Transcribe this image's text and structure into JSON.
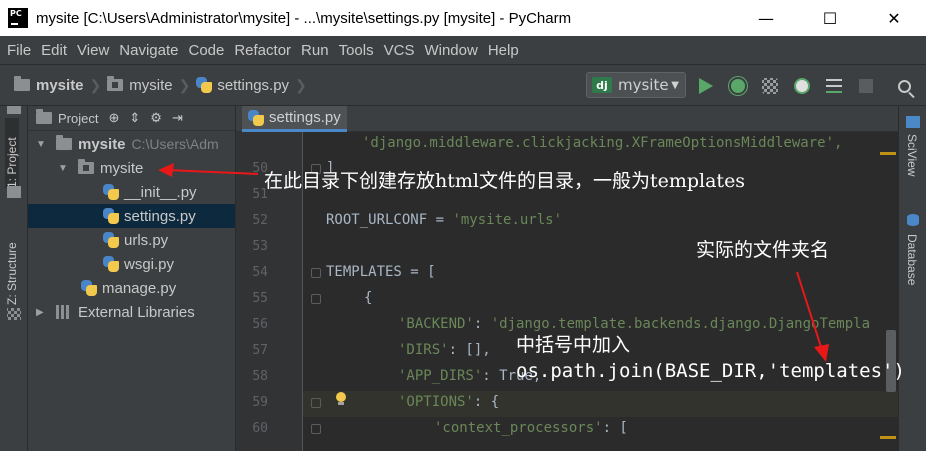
{
  "window": {
    "title": "mysite [C:\\Users\\Administrator\\mysite] - ...\\mysite\\settings.py [mysite] - PyCharm",
    "app_icon_text": "PC",
    "minimize": "—",
    "maximize": "☐",
    "close": "✕"
  },
  "menu": [
    "File",
    "Edit",
    "View",
    "Navigate",
    "Code",
    "Refactor",
    "Run",
    "Tools",
    "VCS",
    "Window",
    "Help"
  ],
  "breadcrumb": [
    "mysite",
    "mysite",
    "settings.py"
  ],
  "run_config": {
    "badge": "dj",
    "name": "mysite"
  },
  "left_strip": {
    "project_tab": "1: Project",
    "structure_tab": "Z: Structure"
  },
  "project_panel": {
    "header_label": "Project",
    "tree": [
      {
        "label": "mysite",
        "detail": "C:\\Users\\Adm",
        "expanded": true
      },
      {
        "label": "mysite",
        "expanded": true
      },
      {
        "label": "__init__.py"
      },
      {
        "label": "settings.py",
        "selected": true
      },
      {
        "label": "urls.py"
      },
      {
        "label": "wsgi.py"
      },
      {
        "label": "manage.py"
      },
      {
        "label": "External Libraries",
        "expanded": false
      }
    ]
  },
  "editor": {
    "tab_label": "settings.py",
    "line_numbers": [
      "",
      "50",
      "51",
      "52",
      "53",
      "54",
      "55",
      "56",
      "57",
      "58",
      "59",
      "60"
    ],
    "lines": {
      "l49": "'django.middleware.clickjacking.XFrameOptionsMiddleware',",
      "l50": "]",
      "l52a": "ROOT_URLCONF = ",
      "l52b": "'mysite.urls'",
      "l54": "TEMPLATES = [",
      "l55": "{",
      "l56a": "'BACKEND'",
      "l56b": ": ",
      "l56c": "'django.template.backends.django.DjangoTempla",
      "l57a": "'DIRS'",
      "l57b": ": [],",
      "l58a": "'APP_DIRS'",
      "l58b": ": True,",
      "l59a": "'OPTIONS'",
      "l59b": ": {",
      "l60a": "'context_processors'",
      "l60b": ": ["
    }
  },
  "right_strip": {
    "sciview": "SciView",
    "database": "Database"
  },
  "annotations": {
    "dir_note": "在此目录下创建存放html文件的目录，一般为templates",
    "folder_name_note": "实际的文件夹名",
    "add_note": "中括号中加入",
    "code_note": "os.path.join(BASE_DIR,'templates')"
  },
  "colors": {
    "arrow": "#e81818",
    "selection": "#0d293e",
    "tab_underline": "#4a88c7"
  }
}
